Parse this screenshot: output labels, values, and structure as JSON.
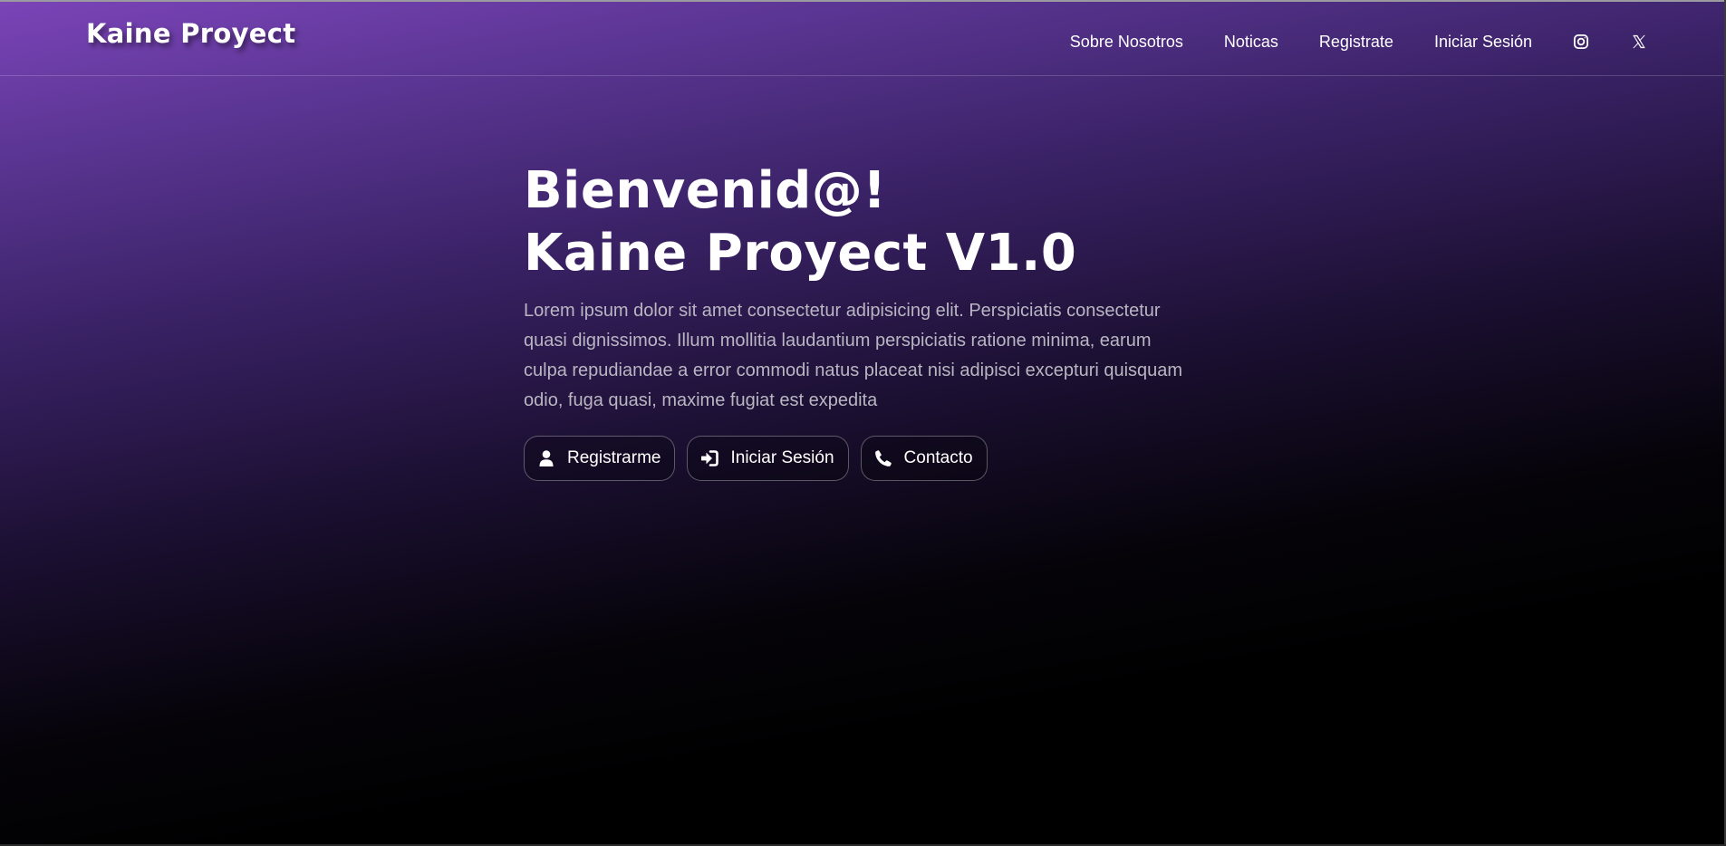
{
  "header": {
    "brand": "Kaine Proyect",
    "nav": [
      {
        "label": "Sobre Nosotros"
      },
      {
        "label": "Noticas"
      },
      {
        "label": "Registrate"
      },
      {
        "label": "Iniciar Sesión"
      }
    ],
    "social_icons": [
      "instagram-icon",
      "x-icon"
    ]
  },
  "hero": {
    "title_line1": "Bienvenid@!",
    "title_line2": "Kaine Proyect V1.0",
    "paragraph": "Lorem ipsum dolor sit amet consectetur adipisicing elit. Perspiciatis consectetur quasi dignissimos. Illum mollitia laudantium perspiciatis ratione minima, earum culpa repudiandae a error commodi natus placeat nisi adipisci excepturi quisquam odio, fuga quasi, maxime fugiat est expedita",
    "buttons": [
      {
        "label": "Registrarme",
        "icon": "user-icon"
      },
      {
        "label": "Iniciar Sesión",
        "icon": "sign-in-icon"
      },
      {
        "label": "Contacto",
        "icon": "phone-icon"
      }
    ]
  },
  "colors": {
    "gradient_top": "#7b44b8",
    "gradient_mid": "#3a2266",
    "background": "#000000",
    "text_primary": "#ffffff",
    "text_muted": "#b9b6c2"
  }
}
